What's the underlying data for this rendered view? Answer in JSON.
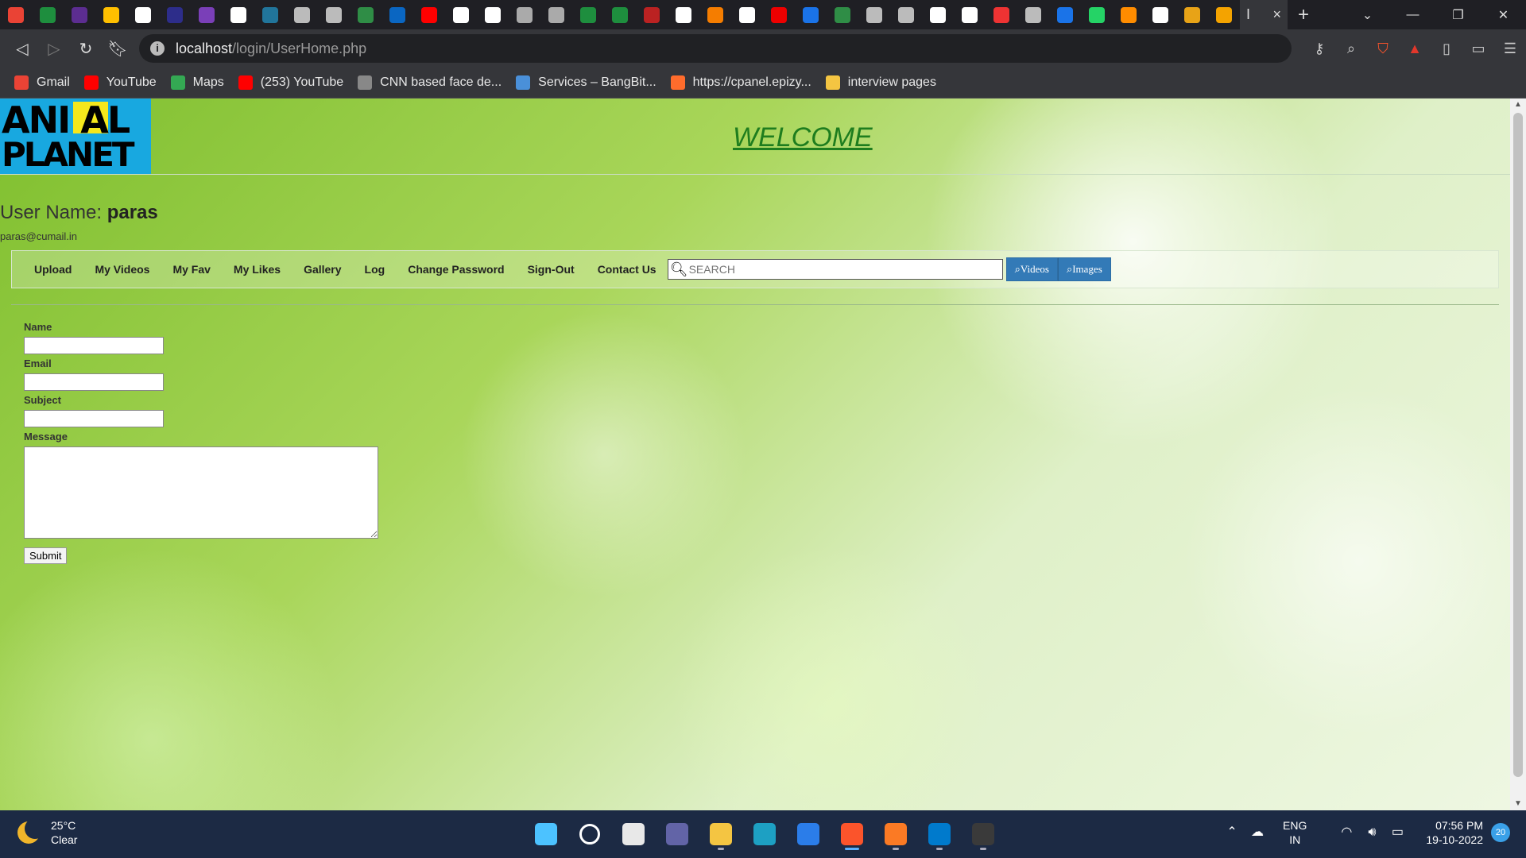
{
  "browser": {
    "active_tab_glyph": "I",
    "tab_close": "×",
    "new_tab": "+",
    "url_host": "localhost",
    "url_path": "/login/UserHome.php",
    "tab_favicons": [
      "#ea4335",
      "#1e8e3e",
      "#5c2d91",
      "#ffbf00",
      "#fff",
      "#2d2d8a",
      "#7a3fb8",
      "#fff",
      "#21759b",
      "#bbb",
      "#bbb",
      "#2f8d46",
      "#0a66c2",
      "#ff0000",
      "#fff",
      "#fff",
      "#aaa",
      "#aaa",
      "#1e8e3e",
      "#1e8e3e",
      "#b22",
      "#fff",
      "#f57d00",
      "#fff",
      "#e00",
      "#1a73e8",
      "#2f8d46",
      "#bbb",
      "#bbb",
      "#fff",
      "#fff",
      "#e33",
      "#bbb",
      "#1a73e8",
      "#25d366",
      "#ff8c00",
      "#fff",
      "#e8a317",
      "#f4a300"
    ],
    "bookmarks": [
      {
        "label": "Gmail",
        "color": "#ea4335"
      },
      {
        "label": "YouTube",
        "color": "#ff0000"
      },
      {
        "label": "Maps",
        "color": "#34a853"
      },
      {
        "label": "(253) YouTube",
        "color": "#ff0000"
      },
      {
        "label": "CNN based face de...",
        "color": "#888"
      },
      {
        "label": "Services – BangBit...",
        "color": "#4a90d9"
      },
      {
        "label": "https://cpanel.epizy...",
        "color": "#ff6c2c"
      },
      {
        "label": "interview pages",
        "color": "#f4c542"
      }
    ]
  },
  "page": {
    "logo_line1": "ANI  AL",
    "logo_line2": "PLANET",
    "welcome": "WELCOME",
    "username_label": "User Name:",
    "username": "paras",
    "email": "paras@cumail.in",
    "nav": [
      "Upload",
      "My Videos",
      "My Fav",
      "My Likes",
      "Gallery",
      "Log",
      "Change Password",
      "Sign-Out",
      "Contact Us"
    ],
    "search_placeholder": "SEARCH",
    "btn_videos": "Videos",
    "btn_images": "Images",
    "form": {
      "name_label": "Name",
      "email_label": "Email",
      "subject_label": "Subject",
      "message_label": "Message",
      "submit": "Submit"
    }
  },
  "taskbar": {
    "temp": "25°C",
    "weather": "Clear",
    "apps": [
      {
        "name": "start",
        "color": "#4cc2ff"
      },
      {
        "name": "search",
        "color": "#1c2a44"
      },
      {
        "name": "task-view",
        "color": "#e8e8e8"
      },
      {
        "name": "chat",
        "color": "#6264a7"
      },
      {
        "name": "file-explorer",
        "color": "#f4c542"
      },
      {
        "name": "edge",
        "color": "#1da0c3"
      },
      {
        "name": "mail",
        "color": "#2b7de9"
      },
      {
        "name": "brave",
        "color": "#fb542b"
      },
      {
        "name": "xampp",
        "color": "#fb7a24"
      },
      {
        "name": "vscode",
        "color": "#007acc"
      },
      {
        "name": "terminal",
        "color": "#3a3a3a"
      }
    ],
    "lang1": "ENG",
    "lang2": "IN",
    "time": "07:56 PM",
    "date": "19-10-2022",
    "notifications": "20"
  }
}
